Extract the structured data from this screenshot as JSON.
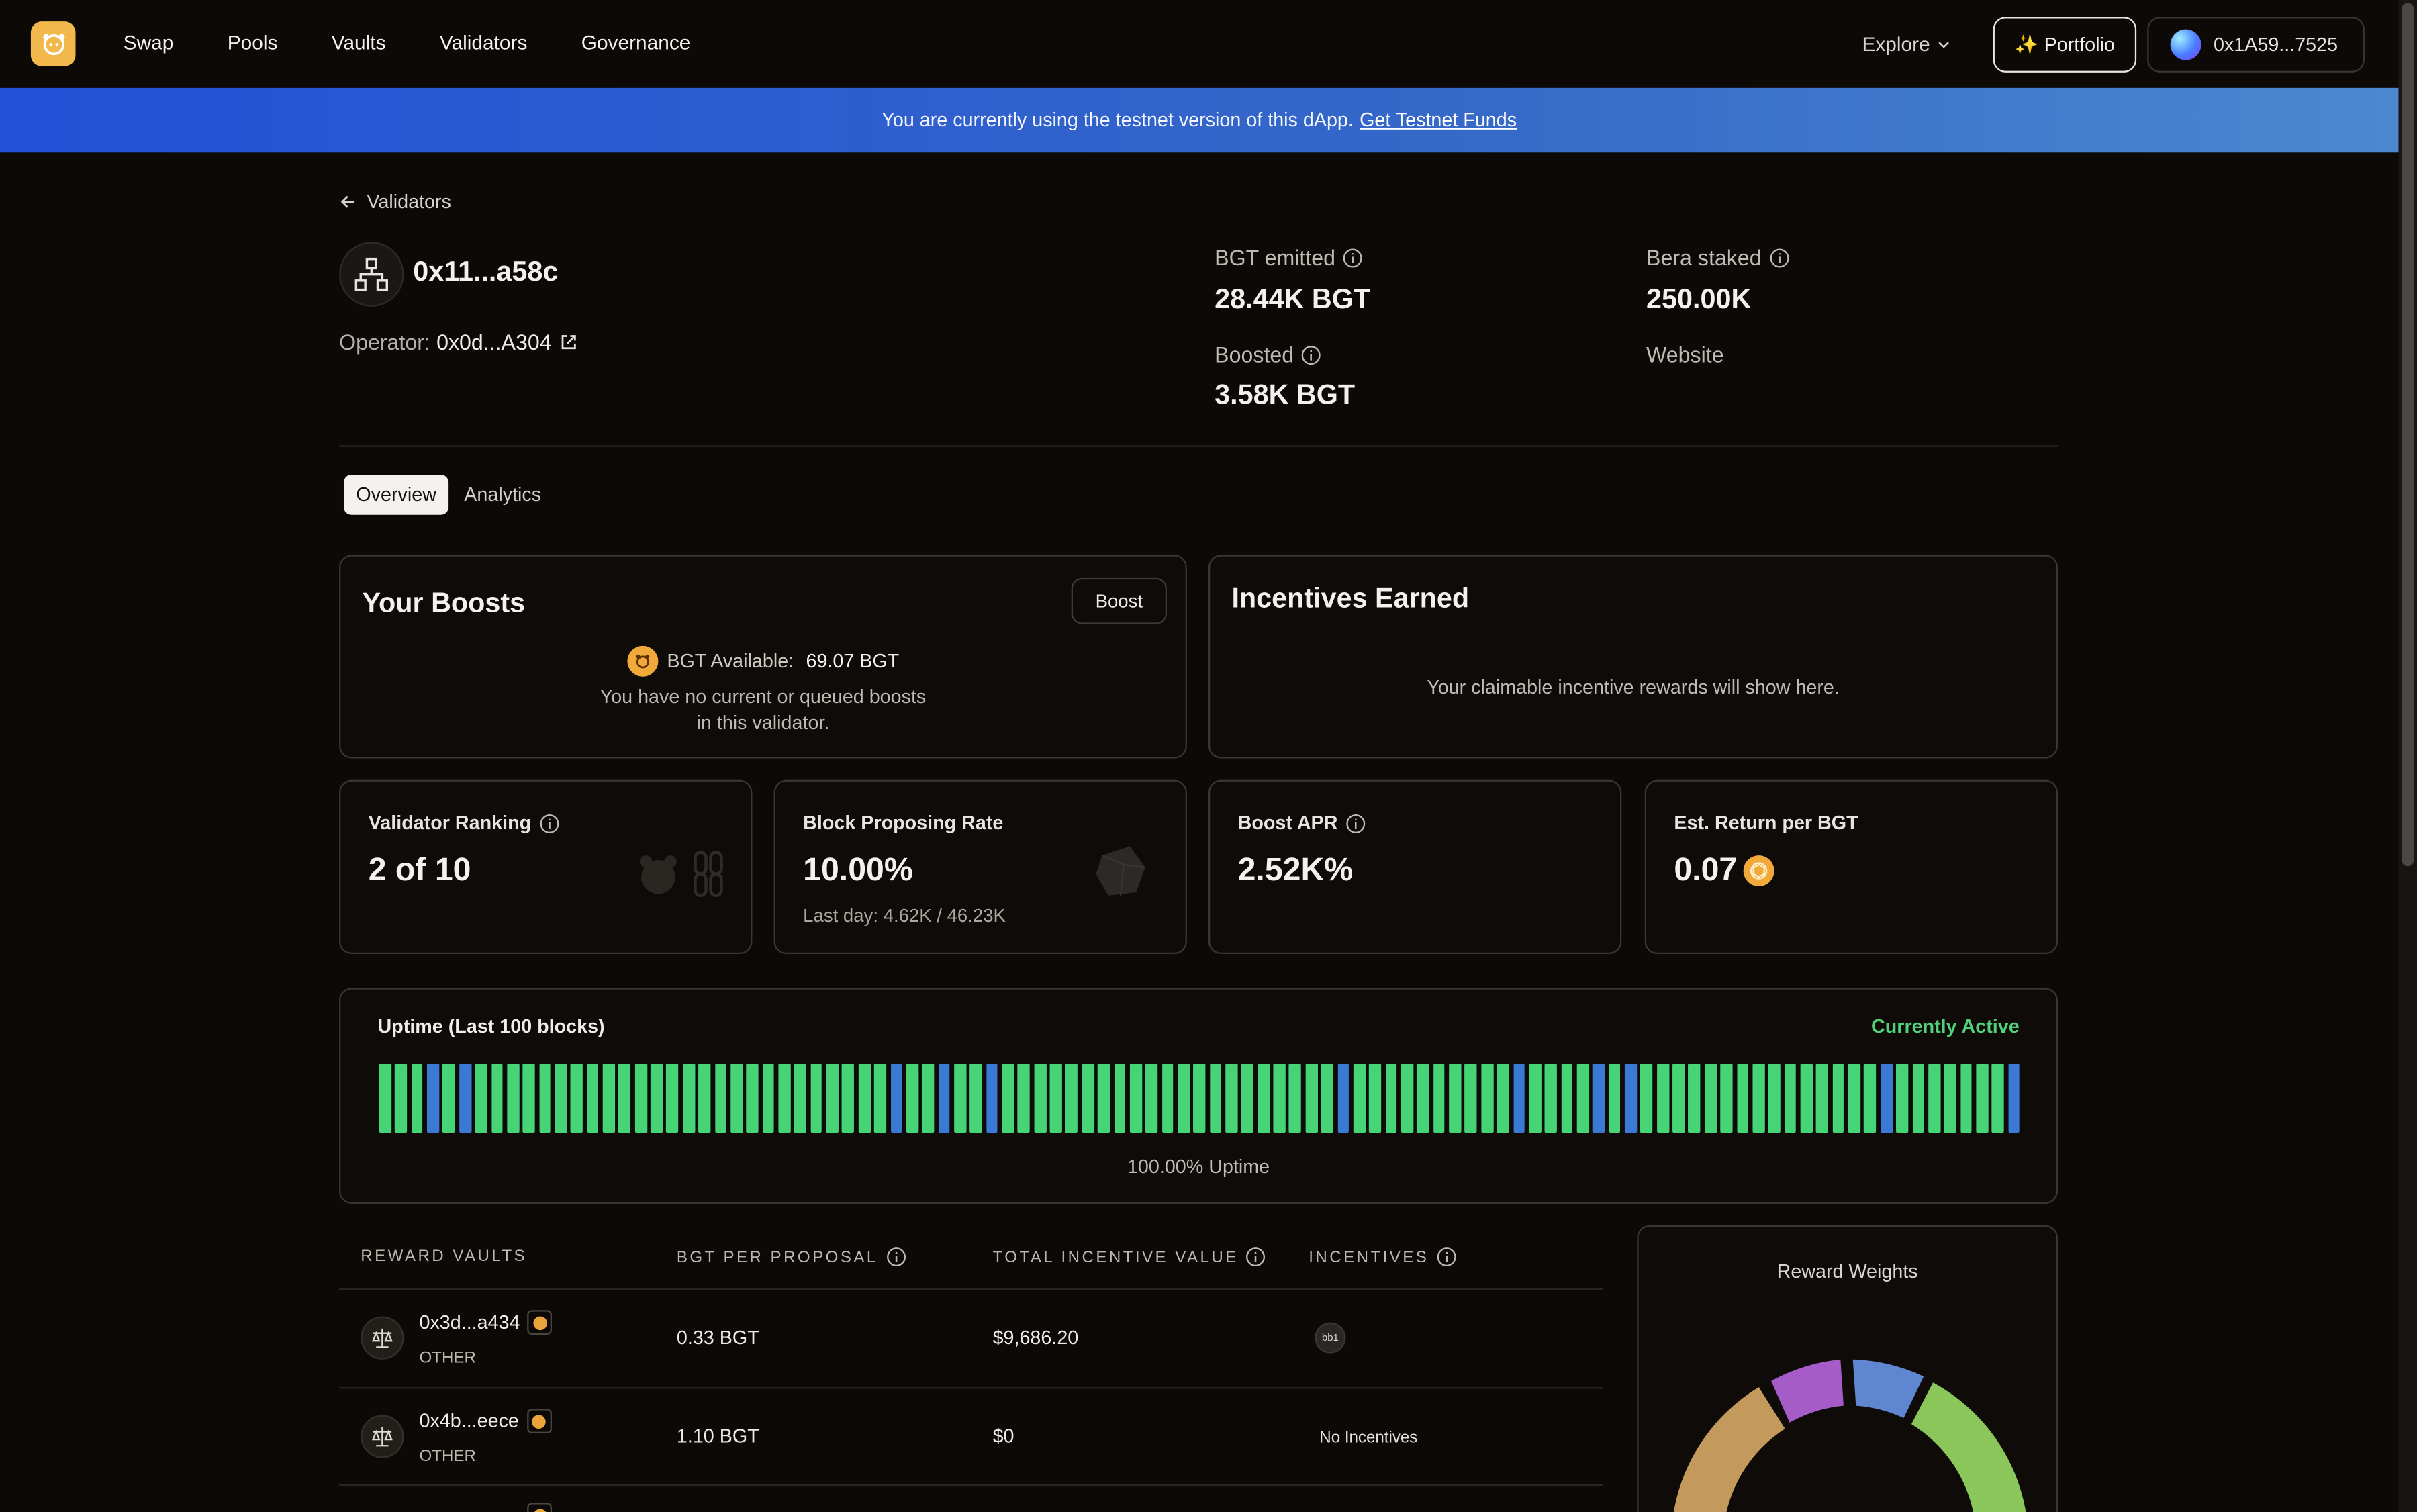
{
  "nav": {
    "links": [
      "Swap",
      "Pools",
      "Vaults",
      "Validators",
      "Governance"
    ],
    "explore": "Explore",
    "portfolio": "✨ Portfolio",
    "wallet": "0x1A59...7525"
  },
  "banner": {
    "text": "You are currently using the testnet version of this dApp.",
    "link": "Get Testnet Funds"
  },
  "header": {
    "back": "Validators",
    "validator_name": "0x11...a58c",
    "operator_label": "Operator:",
    "operator_addr": "0x0d...A304",
    "stats": {
      "bgt_emitted_label": "BGT emitted",
      "bgt_emitted_value": "28.44K BGT",
      "bera_staked_label": "Bera staked",
      "bera_staked_value": "250.00K",
      "boosted_label": "Boosted",
      "boosted_value": "3.58K BGT",
      "website_label": "Website"
    }
  },
  "tabs": [
    "Overview",
    "Analytics"
  ],
  "boosts": {
    "title": "Your Boosts",
    "button": "Boost",
    "available_label": "BGT Available:",
    "available_value": "69.07 BGT",
    "empty_line1": "You have no current or queued boosts",
    "empty_line2": "in this validator."
  },
  "incentives": {
    "title": "Incentives Earned",
    "empty": "Your claimable incentive rewards will show here."
  },
  "metrics": {
    "ranking_label": "Validator Ranking",
    "ranking_value": "2 of 10",
    "proposing_label": "Block Proposing Rate",
    "proposing_value": "10.00%",
    "proposing_sub": "Last day: 4.62K / 46.23K",
    "apr_label": "Boost APR",
    "apr_value": "2.52K%",
    "return_label": "Est. Return per BGT",
    "return_value": "0.07"
  },
  "uptime": {
    "title": "Uptime (Last 100 blocks)",
    "status": "Currently Active",
    "percent": "100.00% Uptime",
    "blocks": "gggbgbggggggggggggggggggggggggggbggbggbgggggggggggggggggggggbggggggggggbggggbgbgggggggggggggggbgggggggb",
    "colors": {
      "green": "#47d476",
      "blue": "#3a79d4"
    }
  },
  "table": {
    "headers": [
      "REWARD VAULTS",
      "BGT PER PROPOSAL",
      "TOTAL INCENTIVE VALUE",
      "INCENTIVES"
    ],
    "rows": [
      {
        "vault": "0x3d...a434",
        "tag": "OTHER",
        "bgt": "0.33 BGT",
        "value": "$9,686.20",
        "incentive_chip": "bb1"
      },
      {
        "vault": "0x4b...eece",
        "tag": "OTHER",
        "bgt": "1.10 BGT",
        "value": "$0",
        "incentive_text": "No Incentives"
      }
    ]
  },
  "weights": {
    "title": "Reward Weights",
    "segment_colors": [
      "#c49a5c",
      "#a55bc8",
      "#5f86d0",
      "#8bc65a"
    ]
  }
}
